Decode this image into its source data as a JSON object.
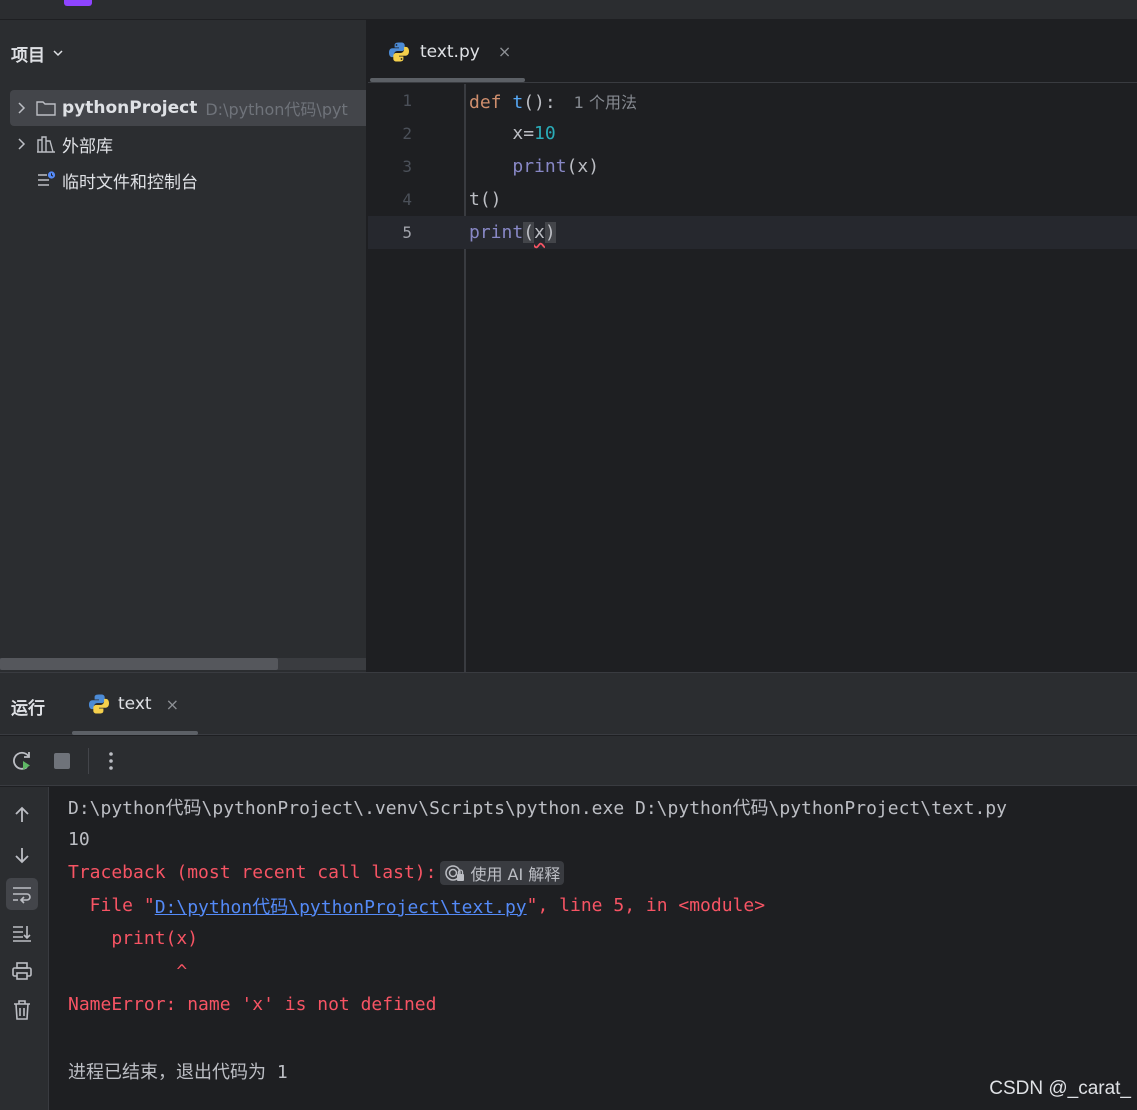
{
  "project": {
    "header": "项目",
    "tree": [
      {
        "name": "pythonProject",
        "path": "D:\\python代码\\pyt"
      },
      {
        "name": "外部库"
      },
      {
        "name": "临时文件和控制台"
      }
    ]
  },
  "editor": {
    "tab": {
      "label": "text.py",
      "close": "×"
    },
    "line_numbers": [
      "1",
      "2",
      "3",
      "4",
      "5"
    ],
    "lines": {
      "l1_kw": "def",
      "l1_fn": "t",
      "l1_rest": "():",
      "l1_hint": "1 个用法",
      "l2_indent": "    ",
      "l2_var": "x=",
      "l2_num": "10",
      "l3_indent": "    ",
      "l3_builtin": "print",
      "l3_rest": "(x)",
      "l4": "t()",
      "l5_builtin": "print",
      "l5_open": "(",
      "l5_arg": "x",
      "l5_close": ")"
    }
  },
  "run": {
    "title": "运行",
    "tab": {
      "label": "text",
      "close": "×"
    },
    "console": {
      "cmd": "D:\\python代码\\pythonProject\\.venv\\Scripts\\python.exe D:\\python代码\\pythonProject\\text.py",
      "out": "10",
      "tb_head": "Traceback (most recent call last):",
      "ai_label": "使用 AI 解释",
      "file_prefix": "  File \"",
      "file_link": "D:\\python代码\\pythonProject\\text.py",
      "file_suffix": "\", line 5, in <module>",
      "src": "    print(x)",
      "caret": "          ^",
      "error": "NameError: name 'x' is not defined",
      "exit": "进程已结束，退出代码为 1"
    }
  },
  "watermark": "CSDN @_carat_",
  "colors": {
    "accent": "#548af7",
    "error": "#f75464",
    "keyword": "#cf8e6d",
    "function": "#56a8f5",
    "number": "#2aacb8",
    "builtin": "#8888c6"
  }
}
